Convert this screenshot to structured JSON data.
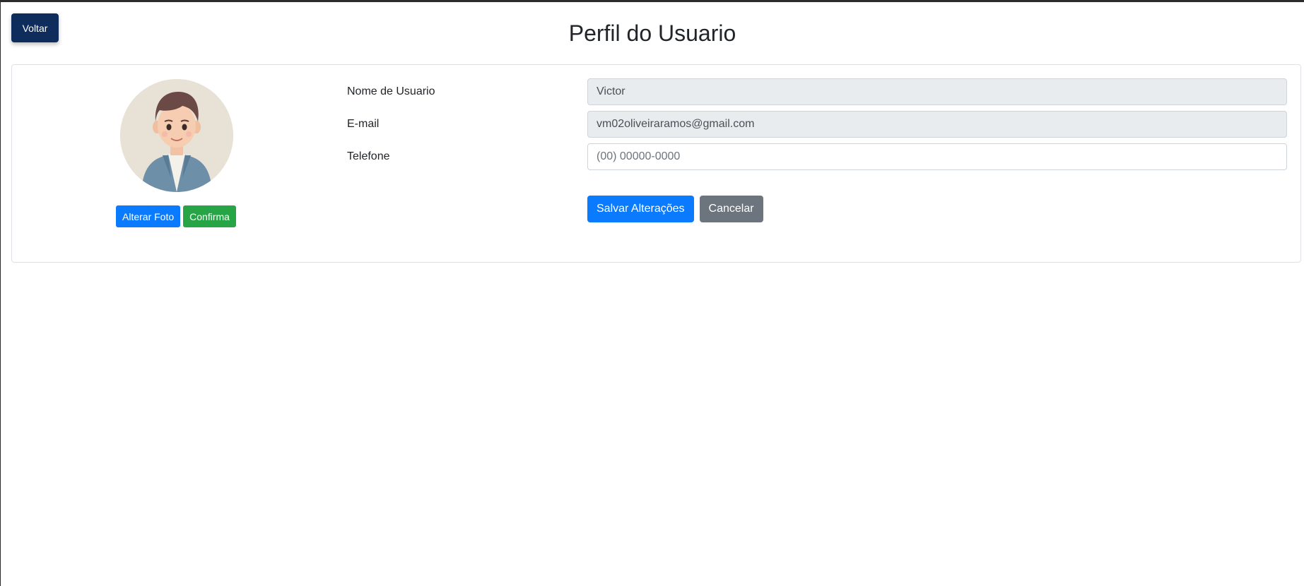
{
  "header": {
    "back_label": "Voltar",
    "title": "Perfil do Usuario"
  },
  "profile": {
    "avatar_icon": "user-avatar-illustration",
    "change_photo_label": "Alterar Foto",
    "confirm_label": "Confirma"
  },
  "form": {
    "username_label": "Nome de Usuario",
    "username_value": "Victor",
    "email_label": "E-mail",
    "email_value": "vm02oliveiraramos@gmail.com",
    "phone_label": "Telefone",
    "phone_placeholder": "(00) 00000-0000",
    "save_label": "Salvar Alterações",
    "cancel_label": "Cancelar"
  },
  "colors": {
    "back_button": "#0f2d5c",
    "primary": "#0a7bff",
    "success": "#27a546",
    "secondary": "#6c757d",
    "readonly_field": "#e9ecef"
  }
}
